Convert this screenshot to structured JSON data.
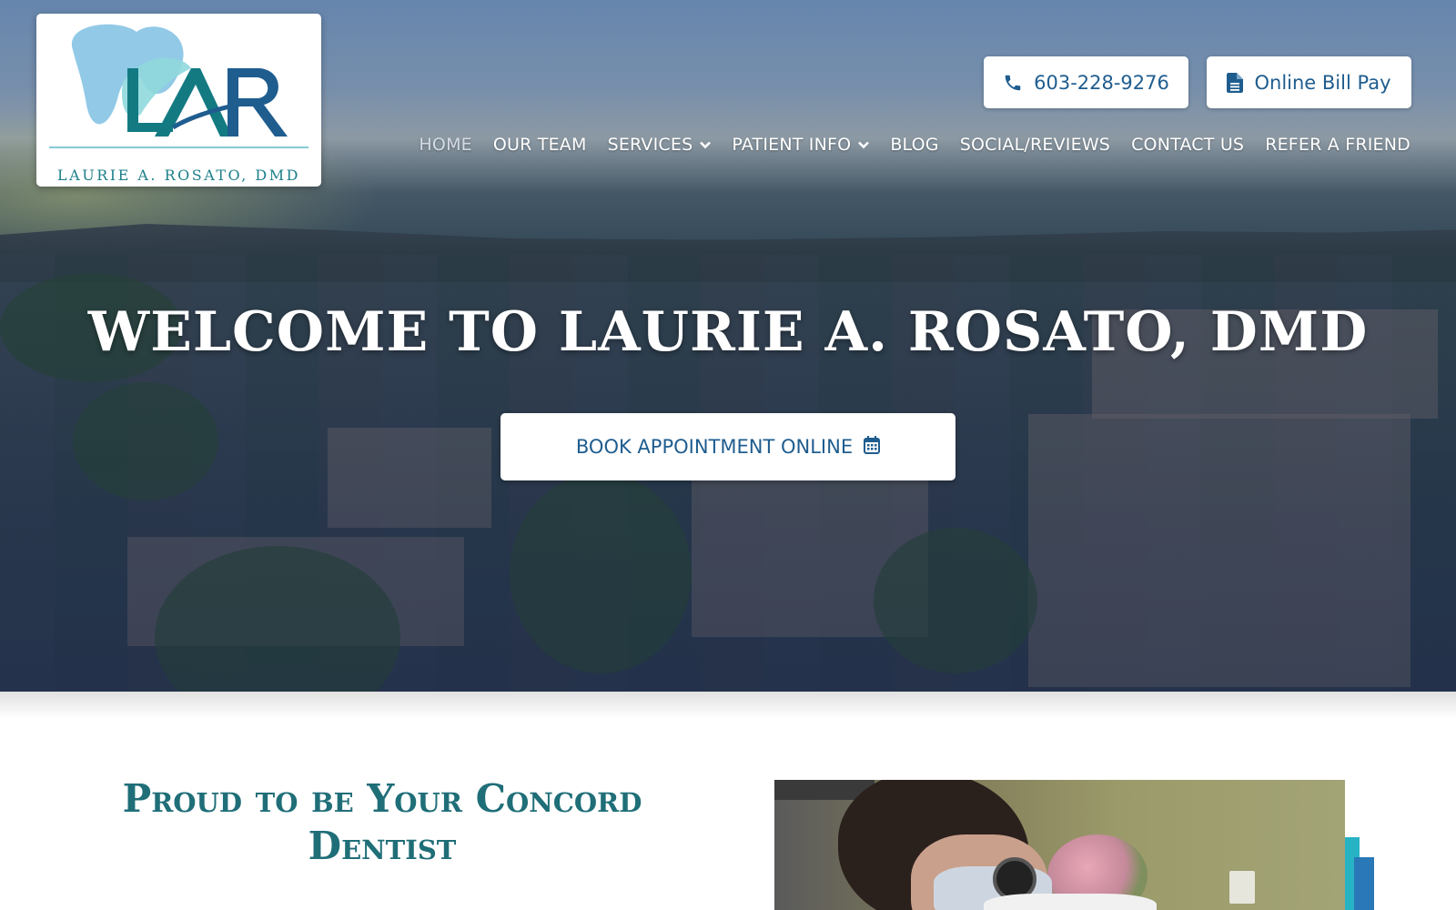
{
  "logo": {
    "monogram": "LAR",
    "caption": "LAURIE A. ROSATO, DMD"
  },
  "header": {
    "phone": {
      "label": "603-228-9276",
      "icon": "phone-icon"
    },
    "bill_pay": {
      "label": "Online Bill Pay",
      "icon": "document-icon"
    }
  },
  "nav": {
    "items": [
      {
        "label": "HOME",
        "active": true,
        "dropdown": false
      },
      {
        "label": "OUR TEAM",
        "active": false,
        "dropdown": false
      },
      {
        "label": "SERVICES",
        "active": false,
        "dropdown": true
      },
      {
        "label": "PATIENT INFO",
        "active": false,
        "dropdown": true
      },
      {
        "label": "BLOG",
        "active": false,
        "dropdown": false
      },
      {
        "label": "SOCIAL/REVIEWS",
        "active": false,
        "dropdown": false
      },
      {
        "label": "CONTACT US",
        "active": false,
        "dropdown": false
      },
      {
        "label": "REFER A FRIEND",
        "active": false,
        "dropdown": false
      }
    ]
  },
  "hero": {
    "title": "WELCOME TO LAURIE A. ROSATO, DMD",
    "book_button": {
      "label": "BOOK APPOINTMENT ONLINE",
      "icon": "calendar-icon"
    }
  },
  "intro": {
    "title_line1": "Proud to be Your Concord",
    "title_line2": "Dentist"
  },
  "colors": {
    "brand_blue": "#1f5d8f",
    "brand_teal": "#1f6e78",
    "accent_cyan": "#27b3c4"
  }
}
